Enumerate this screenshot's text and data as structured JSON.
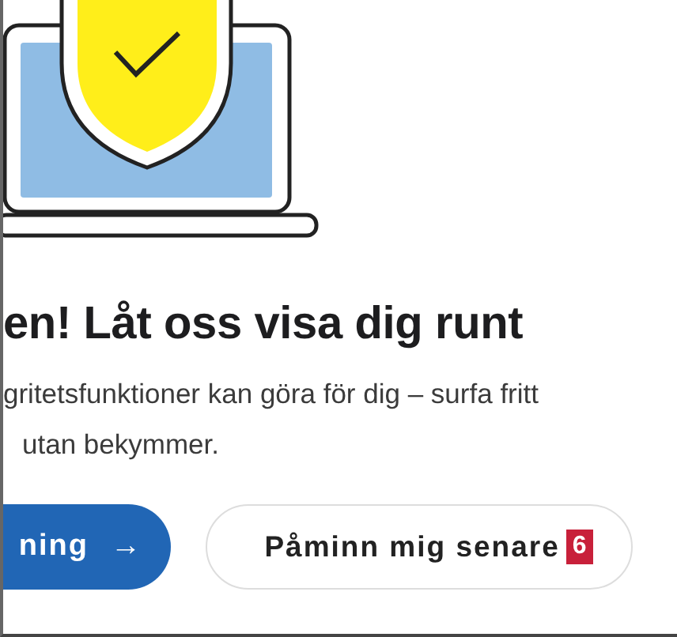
{
  "heading": "en! Låt oss visa dig runt",
  "description_lines": [
    "gritetsfunktioner kan göra för dig – surfa fritt",
    "utan bekymmer."
  ],
  "buttons": [
    {
      "label": "ning",
      "arrow": "→",
      "kind": "primary"
    },
    {
      "label": "Påminn mig senare",
      "kind": "outline",
      "badge": "6"
    }
  ]
}
